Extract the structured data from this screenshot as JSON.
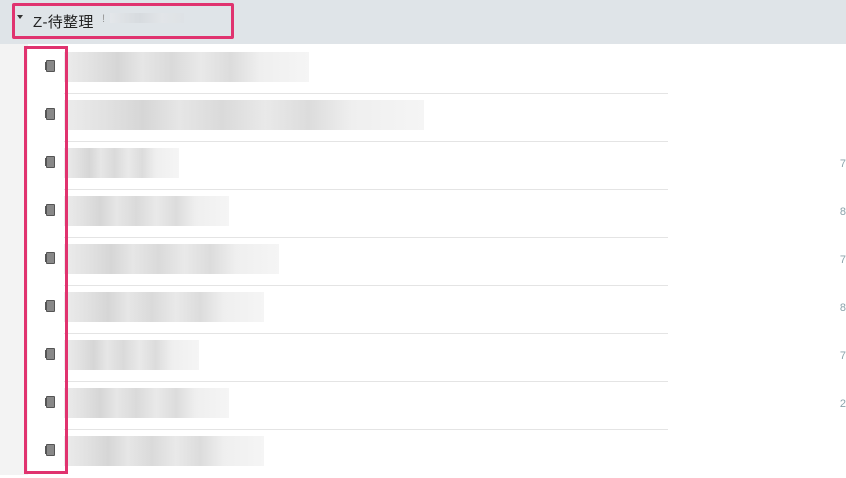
{
  "folder": {
    "title": "Z-待整理",
    "count": "!"
  },
  "notes": [
    {
      "icon": "note-icon",
      "meta": ""
    },
    {
      "icon": "note-icon",
      "meta": ""
    },
    {
      "icon": "note-icon",
      "meta": "7"
    },
    {
      "icon": "note-icon",
      "meta": "8"
    },
    {
      "icon": "note-icon",
      "meta": "7"
    },
    {
      "icon": "note-icon",
      "meta": "8"
    },
    {
      "icon": "note-icon",
      "meta": "7"
    },
    {
      "icon": "note-icon",
      "meta": "2"
    },
    {
      "icon": "note-icon",
      "meta": ""
    }
  ],
  "colors": {
    "header_bg": "#dfe4e8",
    "highlight": "#e0336f"
  }
}
